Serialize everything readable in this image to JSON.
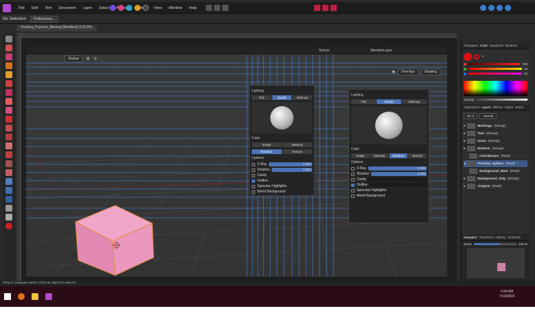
{
  "menu": {
    "items": [
      "File",
      "Edit",
      "Text",
      "Document",
      "Layer",
      "Select",
      "Arrange",
      "Filters",
      "View",
      "Window",
      "Help"
    ]
  },
  "context": {
    "selection": "No Selection",
    "preferences": "Preferences..."
  },
  "document": {
    "tab_title": "Shading_Popover_Mockup [Modified] (125.0%)"
  },
  "blender": {
    "scene_title": "Scene",
    "render_layer": "RenderLayer",
    "transform_orientation": "Global",
    "overlays_label": "Overlays",
    "shading_label": "Shading"
  },
  "shading_left": {
    "lighting_label": "Lighting",
    "lighting_options": [
      "Flat",
      "Studio",
      "MatCap"
    ],
    "color_label": "Color",
    "color_options": [
      "Single",
      "Material",
      "Random",
      "Texture"
    ],
    "options_label": "Options",
    "xray_label": "X-Ray",
    "xray_value": "0.500",
    "shadow_label": "Shadow",
    "shadow_value": "0.500",
    "cavity_label": "Cavity",
    "outline_label": "Outline",
    "specular_label": "Specular Highlights",
    "world_label": "World Background"
  },
  "shading_right": {
    "lighting_label": "Lighting",
    "lighting_options": [
      "Flat",
      "Studio",
      "MatCap"
    ],
    "color_label": "Color",
    "color_options": [
      "Single",
      "Material",
      "Random",
      "Texture"
    ],
    "options_label": "Options",
    "xray_label": "X-Ray",
    "xray_value": "0.500",
    "shadow_label": "Shadow",
    "shadow_value": "0.500",
    "cavity_label": "Cavity",
    "outline_label": "Outline",
    "specular_label": "Specular Highlights",
    "world_label": "World Background"
  },
  "studio": {
    "top_tabs": [
      "Histogram",
      "Color",
      "Swatches",
      "Brushes"
    ],
    "color_values": [
      "236",
      "13",
      "13"
    ],
    "opacity_label": "Opacity",
    "layer_tabs": [
      "Adjustment",
      "Layers",
      "Effects",
      "Styles",
      "Stock"
    ],
    "opacity_value": "50 %",
    "blend_mode": "Normal",
    "layers": [
      {
        "name": "Markings",
        "type": "(Group)"
      },
      {
        "name": "Text",
        "type": "(Group)"
      },
      {
        "name": "Icons",
        "type": "(Group)"
      },
      {
        "name": "Buttons",
        "type": "(Group)"
      },
      {
        "name": "Checkboxes",
        "type": "(Pixel)"
      },
      {
        "name": "Preview_Sphere",
        "type": "(Pixel)"
      },
      {
        "name": "Background_Main",
        "type": "(Pixel)"
      },
      {
        "name": "Background_Orig",
        "type": "(Group)"
      },
      {
        "name": "Original",
        "type": "(Pixel)"
      }
    ],
    "nav_tabs": [
      "Navigator",
      "Transform",
      "History",
      "Channels"
    ],
    "zoom_label": "Zoom",
    "zoom_value": "125 %"
  },
  "status": {
    "text": "Drag to marquee select. Click an object to select it."
  },
  "taskbar": {
    "time": "4:00 AM",
    "date": "7/13/2018"
  },
  "colors": {
    "accent": "#4c73b5",
    "cube": "#e78fb7",
    "taskbar": "#2b0b16"
  }
}
